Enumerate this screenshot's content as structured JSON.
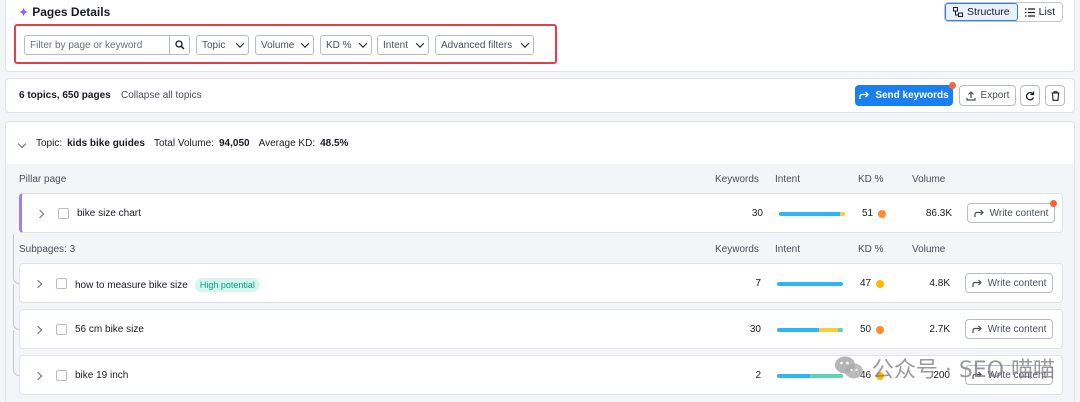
{
  "header": {
    "title": "Pages Details",
    "view_structure": "Structure",
    "view_list": "List"
  },
  "filters": {
    "search_placeholder": "Filter by page or keyword",
    "topic": "Topic",
    "volume": "Volume",
    "kd": "KD %",
    "intent": "Intent",
    "advanced": "Advanced filters"
  },
  "summary": {
    "counts": "6 topics, 650 pages",
    "collapse": "Collapse all topics",
    "send_keywords": "Send keywords",
    "export": "Export"
  },
  "topic": {
    "label": "Topic:",
    "name": "kids bike guides",
    "total_volume_label": "Total Volume:",
    "total_volume": "94,050",
    "avg_kd_label": "Average KD:",
    "avg_kd": "48.5%"
  },
  "pillar": {
    "section_label": "Pillar page",
    "columns": [
      "Keywords",
      "Intent",
      "KD %",
      "Volume"
    ],
    "row": {
      "name": "bike size chart",
      "keywords": "30",
      "kd": "51",
      "kd_color": "#ff8c2d",
      "volume": "86.3K",
      "intent": [
        0.93,
        0.07
      ],
      "write": "Write content"
    }
  },
  "subpages": {
    "section_label": "Subpages: 3",
    "columns": [
      "Keywords",
      "Intent",
      "KD %",
      "Volume"
    ],
    "rows": [
      {
        "name": "how to measure bike size",
        "badge": "High potential",
        "keywords": "7",
        "kd": "47",
        "kd_color": "#ffb800",
        "volume": "4.8K",
        "intent": [
          1.0,
          0,
          0
        ],
        "write": "Write content"
      },
      {
        "name": "56 cm bike size",
        "keywords": "30",
        "kd": "50",
        "kd_color": "#ff8c2d",
        "volume": "2.7K",
        "intent": [
          0.64,
          0.28,
          0.08
        ],
        "write": "Write content"
      },
      {
        "name": "bike 19 inch",
        "keywords": "2",
        "kd": "46",
        "kd_color": "#ffb800",
        "volume": "200",
        "intent": [
          0.5,
          0,
          0.5
        ],
        "write": "Write content"
      }
    ]
  },
  "intent_colors": [
    "#2bb7f5",
    "#ffcc33",
    "#5dd5b0"
  ],
  "watermark": "公众号 · SEO 喵喵"
}
